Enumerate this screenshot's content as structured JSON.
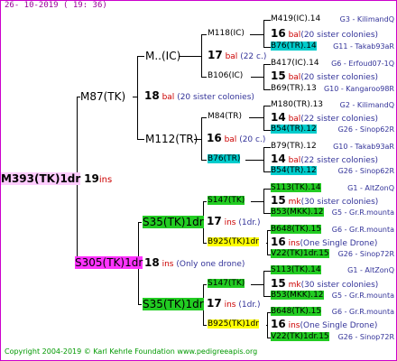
{
  "date_stamp": "26- 10-2019 ( 19: 36)",
  "copyright": "Copyright 2004-2019 © Karl Kehrle Foundation   www.pedigreeapis.org",
  "root": {
    "name": "M393(TK)1dr",
    "n": "19",
    "lab": "ins"
  },
  "sire": {
    "name": "M87(TK)",
    "n": "18",
    "lab": "bal",
    "note": "(20 sister colonies)"
  },
  "dam": {
    "name": "S305(TK)1dr",
    "n": "18",
    "lab": "ins",
    "note": "(Only one drone)"
  },
  "ss": {
    "name": "M..(IC)"
  },
  "sd": {
    "name": "M112(TR)",
    "n": "16",
    "lab": "bal",
    "note": "(20 c.)"
  },
  "sss": {
    "name": "M118(IC)",
    "n": "17",
    "lab": "bal",
    "note": "(22 c.)"
  },
  "ssd": {
    "name": "B106(IC)"
  },
  "sds": {
    "name": "M84(TR)"
  },
  "sdd": {
    "name": "B76(TR)"
  },
  "ds": {
    "name": "S35(TK)1dr",
    "n": "17",
    "lab": "ins",
    "note": "(1dr.)"
  },
  "dd": {
    "name": "S35(TK)1dr",
    "n": "17",
    "lab": "ins",
    "note": "(1dr.)"
  },
  "dsa": {
    "name": "S147(TK)"
  },
  "dsb": {
    "name": "B925(TK)1dr"
  },
  "dda": {
    "name": "S147(TK)"
  },
  "ddb": {
    "name": "B925(TK)1dr"
  },
  "leaves": [
    {
      "name": "M419(IC).14",
      "note": "G3 - KilimandQ"
    },
    {
      "n": "16",
      "lab": "bal",
      "note": "(20 sister colonies)"
    },
    {
      "name": "B76(TR).14",
      "note": "G11 - Takab93aR"
    },
    {
      "name": "B417(IC).14",
      "note": "G6 - Erfoud07-1Q"
    },
    {
      "n": "15",
      "lab": "bal",
      "note": "(20 sister colonies)"
    },
    {
      "name": "B69(TR).13",
      "note": "G10 - Kangaroo98R"
    },
    {
      "name": "M180(TR).13",
      "note": "G2 - KilimandQ"
    },
    {
      "n": "14",
      "lab": "bal",
      "note": "(22 sister colonies)"
    },
    {
      "name": "B54(TR).12",
      "note": "G26 - Sinop62R"
    },
    {
      "name": "B79(TR).12",
      "note": "G10 - Takab93aR"
    },
    {
      "n": "14",
      "lab": "bal",
      "note": "(22 sister colonies)"
    },
    {
      "name": "B54(TR).12",
      "note": "G26 - Sinop62R"
    },
    {
      "name": "S113(TK).14",
      "note": "G1 - AltZonQ"
    },
    {
      "n": "15",
      "lab": "mk",
      "note": "(30 sister colonies)"
    },
    {
      "name": "B53(MKK).12",
      "note": "G5 - Gr.R.mounta"
    },
    {
      "name": "B648(TK).15",
      "note": "G6 - Gr.R.mounta"
    },
    {
      "n": "16",
      "lab": "ins",
      "note": "(One Single Drone)"
    },
    {
      "name": "V22(TK)1dr.15",
      "note": "G26 - Sinop72R"
    },
    {
      "name": "S113(TK).14",
      "note": "G1 - AltZonQ"
    },
    {
      "n": "15",
      "lab": "mk",
      "note": "(30 sister colonies)"
    },
    {
      "name": "B53(MKK).12",
      "note": "G5 - Gr.R.mounta"
    },
    {
      "name": "B648(TK).15",
      "note": "G6 - Gr.R.mounta"
    },
    {
      "n": "16",
      "lab": "ins",
      "note": "(One Single Drone)"
    },
    {
      "name": "V22(TK)1dr.15",
      "note": "G26 - Sinop72R"
    }
  ]
}
